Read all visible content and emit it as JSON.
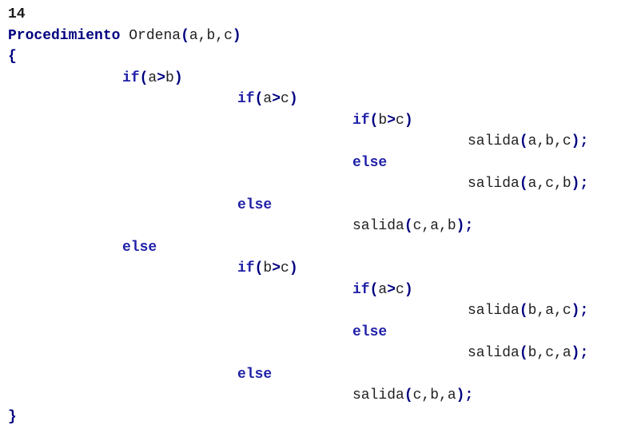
{
  "doc": {
    "number": "14",
    "proc_keyword": "Procedimiento",
    "proc_name": "Ordena",
    "proc_args": "a,b,c",
    "open_brace": "{",
    "close_brace": "}",
    "kw_if": "if",
    "kw_else": "else",
    "cond": {
      "a_gt_b": [
        "a",
        "b"
      ],
      "a_gt_c": [
        "a",
        "c"
      ],
      "b_gt_c": [
        "b",
        "c"
      ]
    },
    "out_fn": "salida",
    "calls": {
      "abc": "a,b,c",
      "acb": "a,c,b",
      "cab": "c,a,b",
      "bac": "b,a,c",
      "bca": "b,c,a",
      "cba": "c,b,a"
    }
  }
}
